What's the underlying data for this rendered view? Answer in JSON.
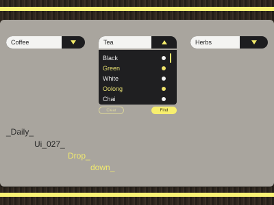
{
  "dropdowns": [
    {
      "value": "Coffee",
      "state": "collapsed"
    },
    {
      "value": "Tea",
      "state": "expanded"
    },
    {
      "value": "Herbs",
      "state": "collapsed"
    }
  ],
  "tea_options": [
    {
      "label": "Black",
      "selected": false
    },
    {
      "label": "Green",
      "selected": true
    },
    {
      "label": "White",
      "selected": false
    },
    {
      "label": "Oolong",
      "selected": true
    },
    {
      "label": "Chai",
      "selected": false
    }
  ],
  "buttons": {
    "clear": "Clear",
    "find": "Find"
  },
  "title_lines": [
    "_Daily_",
    "Ui_027_",
    "Drop_",
    "down_"
  ],
  "colors": {
    "accent": "#f4ec6a",
    "panel": "#a9a59e",
    "dark": "#1d1d1f"
  }
}
